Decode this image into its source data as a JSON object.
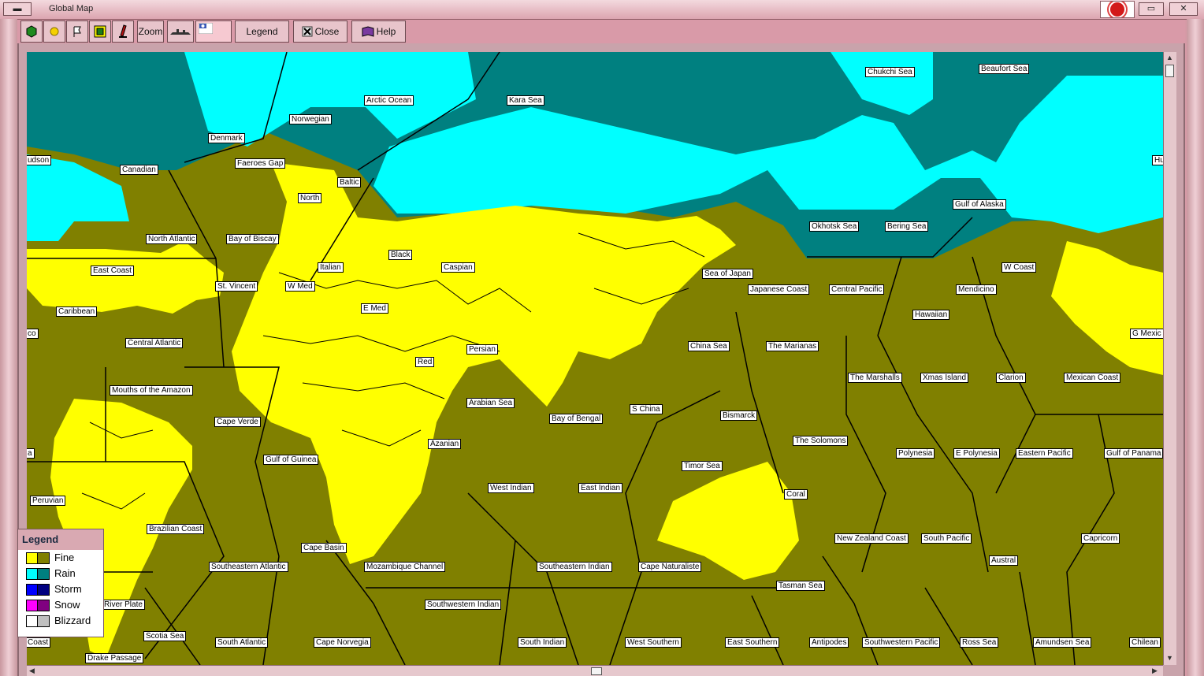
{
  "window": {
    "title": "Global Map",
    "minimize_icon": "minimize-icon",
    "close_icon": "close-icon",
    "flag_icon": "rising-sun-flag-icon"
  },
  "toolbar": {
    "buttons": [
      {
        "icon": "green-hexagon-icon",
        "label": ""
      },
      {
        "icon": "sun-icon",
        "label": ""
      },
      {
        "icon": "flag-outline-icon",
        "label": ""
      },
      {
        "icon": "map-icon",
        "label": ""
      },
      {
        "icon": "pen-icon",
        "label": ""
      },
      {
        "icon": "",
        "label": "Zoom"
      },
      {
        "icon": "ship-silhouette-icon",
        "label": ""
      },
      {
        "icon": "nationality-flag-icon",
        "label": ""
      },
      {
        "icon": "",
        "label": "Legend"
      },
      {
        "icon": "close-tool-icon",
        "label": "Close"
      },
      {
        "icon": "help-book-icon",
        "label": "Help"
      }
    ]
  },
  "legend": {
    "title": "Legend",
    "items": [
      {
        "label": "Fine",
        "colors": [
          "#ffff00",
          "#808000"
        ]
      },
      {
        "label": "Rain",
        "colors": [
          "#00ffff",
          "#008080"
        ]
      },
      {
        "label": "Storm",
        "colors": [
          "#0000ff",
          "#000080"
        ]
      },
      {
        "label": "Snow",
        "colors": [
          "#ff00ff",
          "#800080"
        ]
      },
      {
        "label": "Blizzard",
        "colors": [
          "#ffffff",
          "#c0c0c0"
        ]
      }
    ]
  },
  "colors": {
    "fine_land": "#ffff00",
    "fine_sea": "#808000",
    "rain_land": "#00ffff",
    "rain_sea": "#008080",
    "window_chrome": "#d69aa6"
  },
  "sea_zones": [
    "Chukchi Sea",
    "Beaufort Sea",
    "Arctic Ocean",
    "Kara Sea",
    "Norwegian",
    "Denmark",
    "udson",
    "Canadian",
    "Faeroes Gap",
    "Baltic",
    "North",
    "Hu",
    "Gulf of Alaska",
    "Okhotsk Sea",
    "Bering Sea",
    "North Atlantic",
    "Bay of Biscay",
    "Black",
    "Caspian",
    "East Coast",
    "Italian",
    "W Coast",
    "Sea of Japan",
    "St. Vincent",
    "W Med",
    "Japanese Coast",
    "Central Pacific",
    "Mendicino",
    "E Med",
    "Caribbean",
    "Hawaiian",
    "co",
    "G Mexic",
    "Central Atlantic",
    "Persian",
    "China Sea",
    "The Marianas",
    "Red",
    "The Marshalls",
    "Xmas Island",
    "Clarion",
    "Mexican Coast",
    "Mouths of the Amazon",
    "Arabian Sea",
    "S China",
    "Bismarck",
    "Bay of Bengal",
    "Cape Verde",
    "Azanian",
    "The Solomons",
    "a",
    "Polynesia",
    "E Polynesia",
    "Eastern Pacific",
    "Gulf of Panama",
    "Gulf of Guinea",
    "Timor Sea",
    "West Indian",
    "East Indian",
    "Coral",
    "Peruvian",
    "Brazilian Coast",
    "New Zealand Coast",
    "South Pacific",
    "Capricorn",
    "Cape Basin",
    "Austral",
    "Southeastern Atlantic",
    "Mozambique Channel",
    "Southeastern Indian",
    "Cape Naturaliste",
    "Tasman Sea",
    "River Plate",
    "Southwestern Indian",
    "Scotia Sea",
    "Coast",
    "South Atlantic",
    "Cape Norvegia",
    "South Indian",
    "West Southern",
    "East Southern",
    "Antipodes",
    "Southwestern Pacific",
    "Ross Sea",
    "Amundsen Sea",
    "Chilean",
    "Drake Passage"
  ],
  "scrollbars": {
    "up_icon": "scroll-up-arrow-icon",
    "down_icon": "scroll-down-arrow-icon",
    "left_icon": "scroll-left-arrow-icon",
    "right_icon": "scroll-right-arrow-icon"
  }
}
